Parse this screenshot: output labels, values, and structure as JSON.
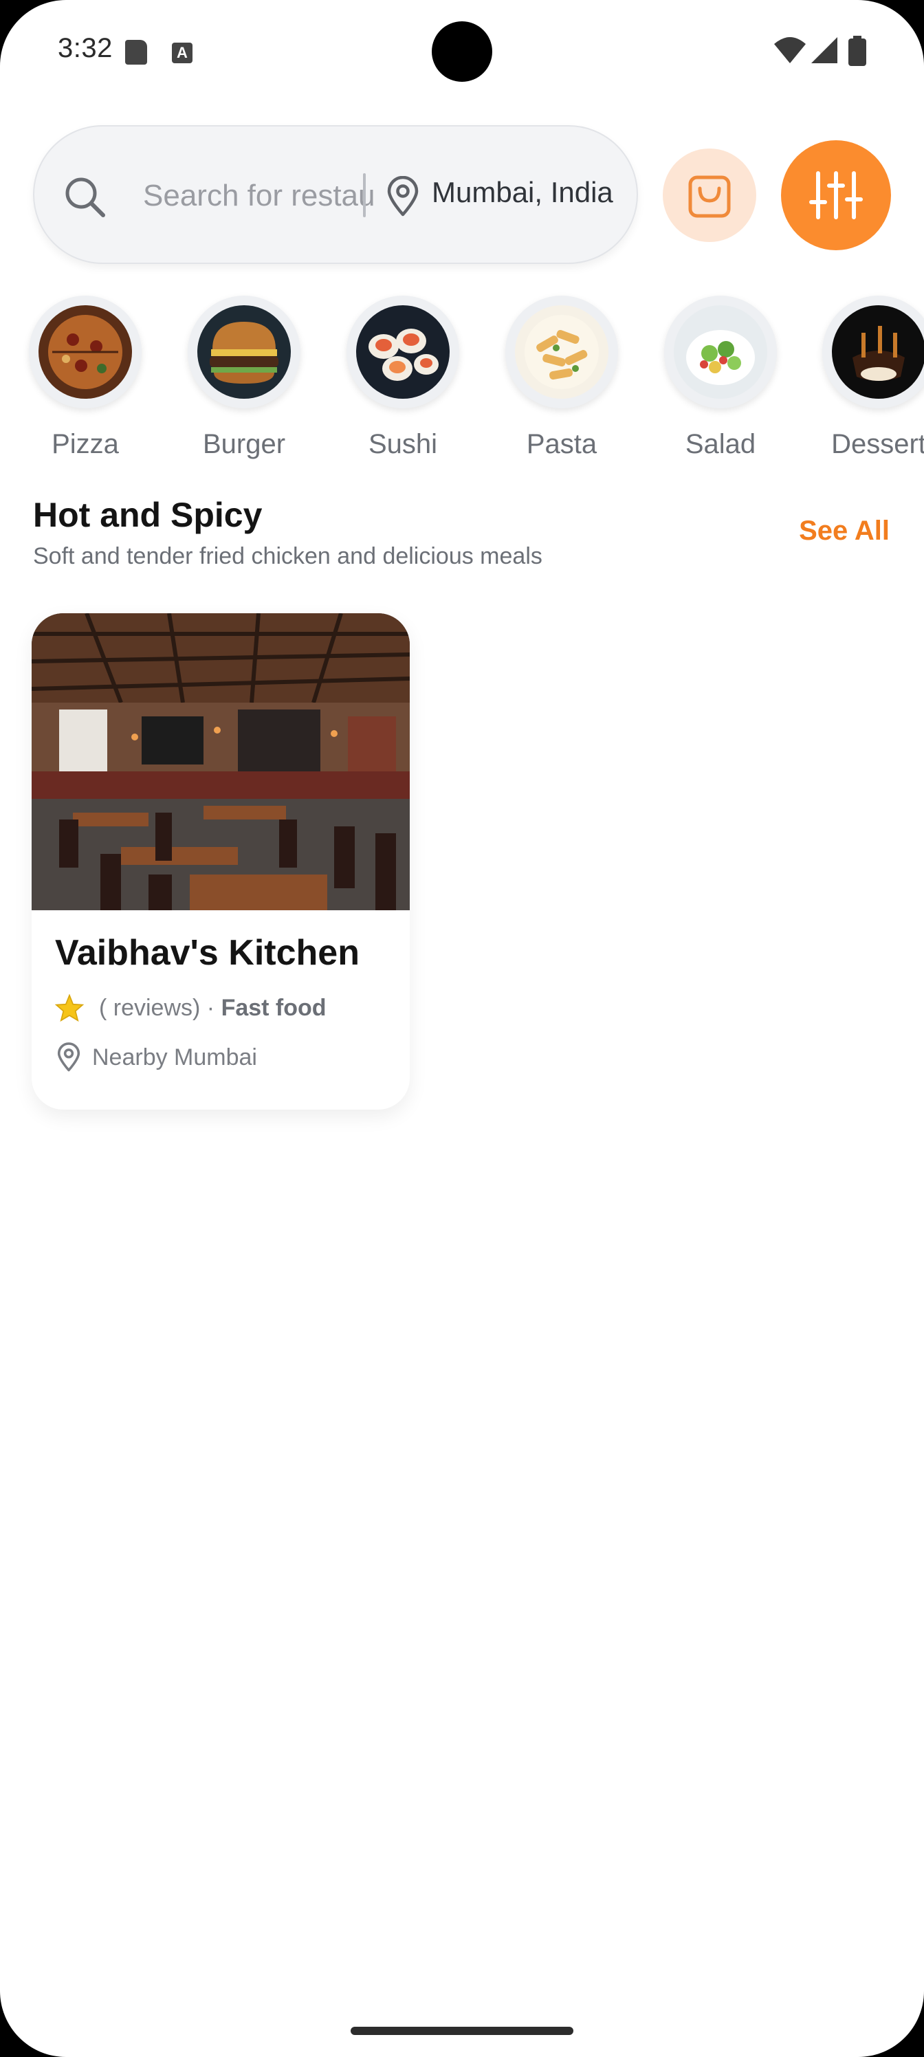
{
  "status_bar": {
    "time": "3:32",
    "notification_icons": [
      "sd-card-icon",
      "a-text-icon"
    ],
    "system_icons": [
      "wifi-icon",
      "signal-icon",
      "battery-icon"
    ]
  },
  "search": {
    "placeholder": "Search for restaurants",
    "location": "Mumbai, India"
  },
  "header_buttons": {
    "cart": "shopping-bag-icon",
    "filter": "sliders-icon"
  },
  "categories": [
    {
      "label": "Pizza"
    },
    {
      "label": "Burger"
    },
    {
      "label": "Sushi"
    },
    {
      "label": "Pasta"
    },
    {
      "label": "Salad"
    },
    {
      "label": "Dessert"
    }
  ],
  "section": {
    "title": "Hot and Spicy",
    "subtitle": "Soft and tender fried chicken and delicious meals",
    "see_all": "See All"
  },
  "restaurants": [
    {
      "name": "Vaibhav's Kitchen",
      "reviews": "( reviews) · ",
      "cuisine": "Fast food",
      "address": "Nearby Mumbai"
    }
  ],
  "colors": {
    "accent": "#f27d1e",
    "filter_button": "#fb8c2e",
    "cart_button_bg": "#fde5d4",
    "star": "#f6c419"
  }
}
